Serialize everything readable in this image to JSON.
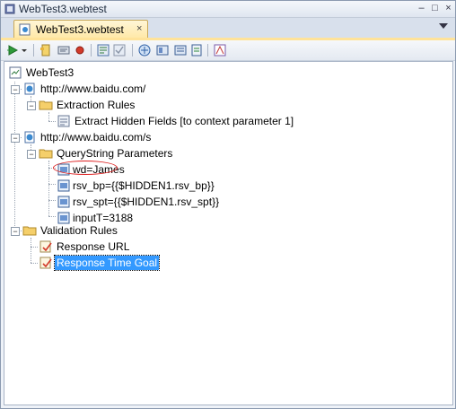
{
  "window": {
    "title": "WebTest3.webtest"
  },
  "tab": {
    "label": "WebTest3.webtest",
    "close_glyph": "×"
  },
  "toolbar": {
    "icons": [
      "run-test-icon",
      "dropdown-arrow-icon",
      "add-request-icon",
      "insert-comment-icon",
      "record-icon",
      "extract-icon",
      "validate-icon",
      "parameterize-icon",
      "context-icon",
      "credentials-icon",
      "plugin-icon",
      "generate-code-icon"
    ]
  },
  "tree": {
    "root": "WebTest3",
    "request1": {
      "url": "http://www.baidu.com/",
      "extraction_rules": "Extraction Rules",
      "extract_rule": "Extract Hidden Fields [to context parameter 1]"
    },
    "request2": {
      "url": "http://www.baidu.com/s",
      "querystring": "QueryString Parameters",
      "params": [
        "wd=James",
        "rsv_bp={{$HIDDEN1.rsv_bp}}",
        "rsv_spt={{$HIDDEN1.rsv_spt}}",
        "inputT=3188"
      ]
    },
    "validation": {
      "label": "Validation Rules",
      "rules": [
        "Response URL",
        "Response Time Goal"
      ]
    }
  },
  "colors": {
    "selection": "#3399ff",
    "annotation": "#dd2222",
    "tab_active": "#ffe8a6"
  }
}
